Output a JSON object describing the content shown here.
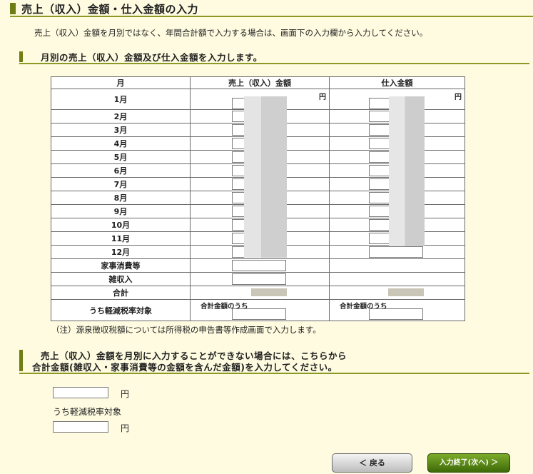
{
  "page": {
    "title": "売上（収入）金額・仕入金額の入力",
    "intro": "売上（収入）金額を月別ではなく、年間合計額で入力する場合は、画面下の入力欄から入力してください。",
    "monthly_section_title": "月別の売上（収入）金額及び仕入金額を入力します。"
  },
  "table": {
    "headers": {
      "month": "月",
      "sales": "売上（収入）金額",
      "purchase": "仕入金額"
    },
    "yen": "円",
    "months": [
      "1月",
      "2月",
      "3月",
      "4月",
      "5月",
      "6月",
      "7月",
      "8月",
      "9月",
      "10月",
      "11月",
      "12月"
    ],
    "extra_rows": {
      "household": "家事消費等",
      "misc_income": "雑収入",
      "total": "合計"
    },
    "reduced_rate": {
      "label": "うち軽減税率対象",
      "sales_sub": "合計金額のうち",
      "purchase_sub": "合計金額のうち"
    }
  },
  "note": "（注）源泉徴収税額については所得税の申告書等作成画面で入力します。",
  "annual_section": {
    "title_line1": "売上（収入）金額を月別に入力することができない場合には、こちらから",
    "title_line2": "合計金額(雑収入・家事消費等の金額を含んだ金額)を入力してください。",
    "yen": "円",
    "reduced_label": "うち軽減税率対象"
  },
  "buttons": {
    "back": "＜  戻る",
    "next": "入力終了(次へ) ＞"
  }
}
